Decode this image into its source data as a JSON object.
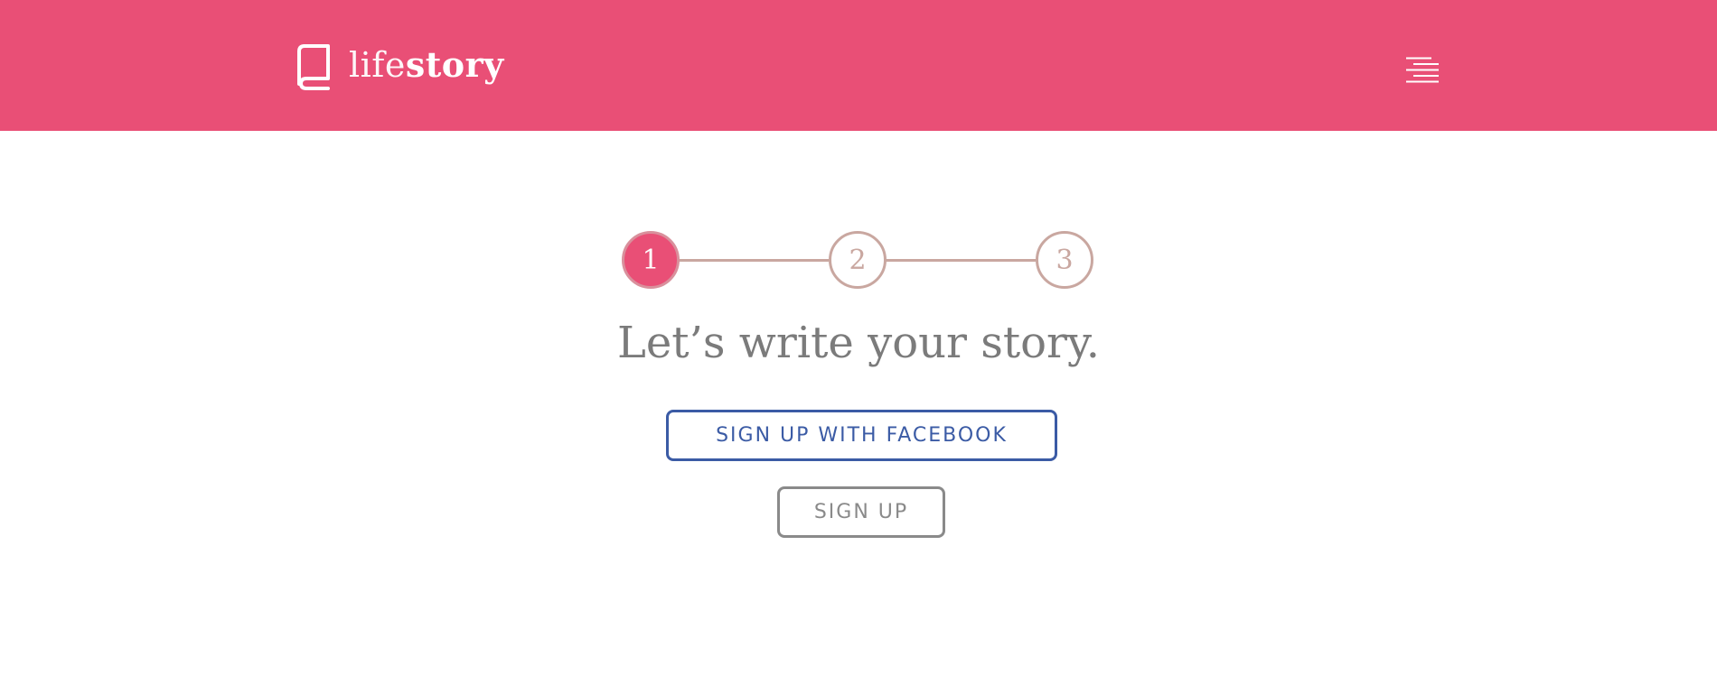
{
  "header": {
    "brand_light": "life",
    "brand_bold": "story",
    "logo_icon": "book-icon",
    "menu_icon": "hamburger-menu-icon",
    "background_color": "#e94f76"
  },
  "stepper": {
    "steps": [
      {
        "label": "1",
        "state": "active"
      },
      {
        "label": "2",
        "state": "inactive"
      },
      {
        "label": "3",
        "state": "inactive"
      }
    ],
    "active_color": "#e94f76",
    "inactive_color": "#c9a7a0"
  },
  "main": {
    "headline": "Let’s write your story.",
    "facebook_button_label": "SIGN UP WITH FACEBOOK",
    "signup_button_label": "SIGN UP",
    "facebook_color": "#3b5ba5"
  }
}
